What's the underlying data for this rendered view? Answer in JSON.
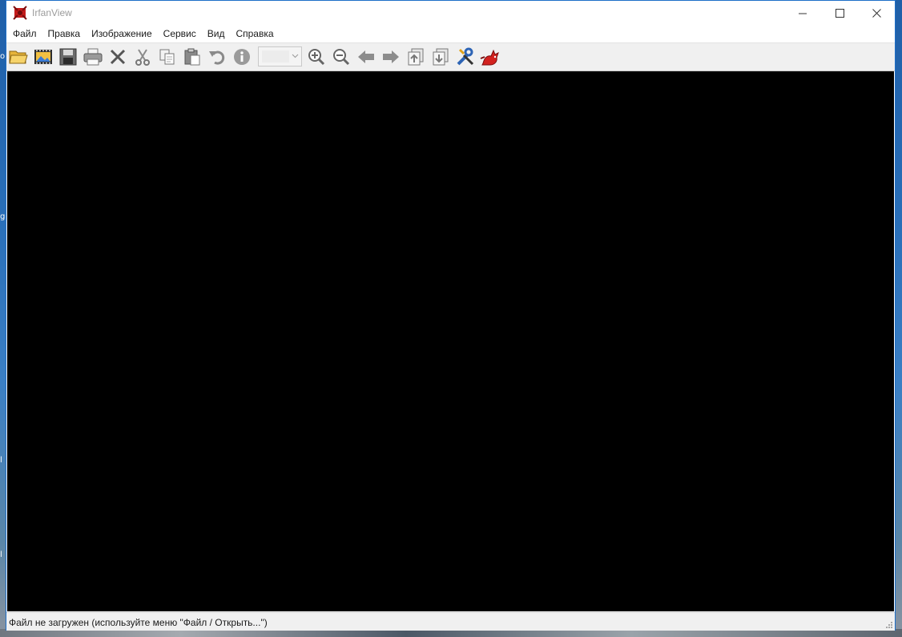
{
  "window": {
    "title": "IrfanView",
    "controls": {
      "minimize_icon": "minimize-icon",
      "maximize_icon": "maximize-icon",
      "close_icon": "close-icon"
    }
  },
  "menu": {
    "items": [
      {
        "id": "file",
        "label": "Файл"
      },
      {
        "id": "edit",
        "label": "Правка"
      },
      {
        "id": "image",
        "label": "Изображение"
      },
      {
        "id": "tools",
        "label": "Сервис"
      },
      {
        "id": "view",
        "label": "Вид"
      },
      {
        "id": "help",
        "label": "Справка"
      }
    ]
  },
  "toolbar": {
    "buttons": [
      {
        "id": "open",
        "icon": "open-folder-icon"
      },
      {
        "id": "slideshow",
        "icon": "slideshow-icon"
      },
      {
        "id": "save",
        "icon": "save-icon"
      },
      {
        "id": "print",
        "icon": "print-icon"
      },
      {
        "id": "delete",
        "icon": "delete-icon"
      },
      {
        "id": "cut",
        "icon": "cut-icon"
      },
      {
        "id": "copy",
        "icon": "copy-icon"
      },
      {
        "id": "paste",
        "icon": "paste-icon"
      },
      {
        "id": "undo",
        "icon": "undo-icon"
      },
      {
        "id": "info",
        "icon": "info-icon"
      },
      {
        "id": "zoom-in",
        "icon": "zoom-in-icon"
      },
      {
        "id": "zoom-out",
        "icon": "zoom-out-icon"
      },
      {
        "id": "previous",
        "icon": "arrow-left-icon"
      },
      {
        "id": "next",
        "icon": "arrow-right-icon"
      },
      {
        "id": "first",
        "icon": "first-file-icon"
      },
      {
        "id": "last",
        "icon": "last-file-icon"
      },
      {
        "id": "options",
        "icon": "tools-icon"
      },
      {
        "id": "about",
        "icon": "irfanview-cat-icon"
      }
    ],
    "zoom_select": {
      "value": ""
    }
  },
  "statusbar": {
    "text": "Файл не загружен (используйте меню \"Файл / Открыть...\")"
  },
  "colors": {
    "canvas": "#000000",
    "window_border": "#1e6fc8",
    "chrome": "#f0f0f0"
  }
}
